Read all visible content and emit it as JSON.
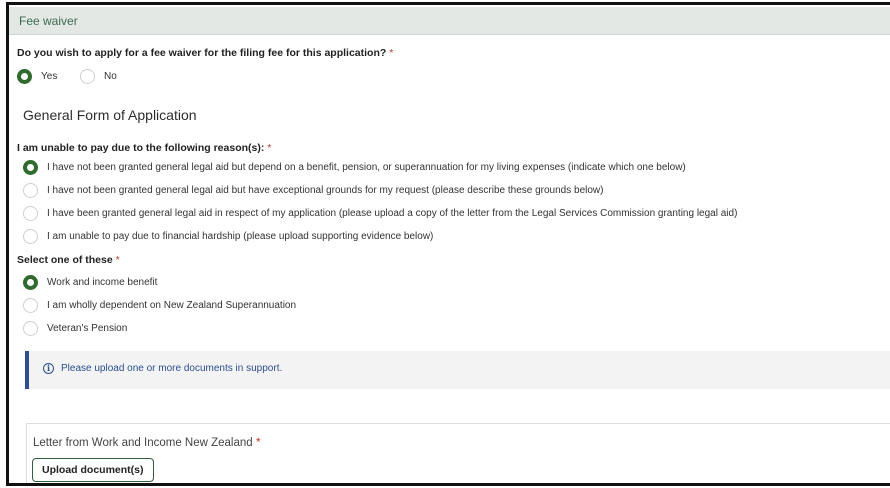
{
  "section": {
    "title": "Fee waiver"
  },
  "fee_waiver_question": {
    "label": "Do you wish to apply for a fee waiver for the filing fee for this application?",
    "required_mark": "*",
    "options": [
      {
        "label": "Yes",
        "checked": true
      },
      {
        "label": "No",
        "checked": false
      }
    ]
  },
  "form_heading": "General Form of Application",
  "reason_question": {
    "label": "I am unable to pay due to the following reason(s):",
    "required_mark": "*",
    "options": [
      {
        "label": "I have not been granted general legal aid but depend on a benefit, pension, or superannuation for my living expenses (indicate which one below)",
        "checked": true
      },
      {
        "label": "I have not been granted general legal aid but have exceptional grounds for my request (please describe these grounds below)",
        "checked": false
      },
      {
        "label": "I have been granted general legal aid in respect of my application (please upload a copy of the letter from the Legal Services Commission granting legal aid)",
        "checked": false
      },
      {
        "label": "I am unable to pay due to financial hardship (please upload supporting evidence below)",
        "checked": false
      }
    ]
  },
  "select_question": {
    "label": "Select one of these",
    "required_mark": "*",
    "options": [
      {
        "label": "Work and income benefit",
        "checked": true
      },
      {
        "label": "I am wholly dependent on New Zealand Superannuation",
        "checked": false
      },
      {
        "label": "Veteran's Pension",
        "checked": false
      }
    ]
  },
  "info": {
    "icon": "info-icon",
    "text": "Please upload one or more documents in support."
  },
  "upload": {
    "label": "Letter from Work and Income New Zealand",
    "required_mark": "*",
    "button_label": "Upload document(s)"
  },
  "colors": {
    "accent_green": "#2f6b2f",
    "header_bg": "#e3e8e5",
    "info_blue": "#2b4f8f",
    "required_red": "#c0392b"
  }
}
